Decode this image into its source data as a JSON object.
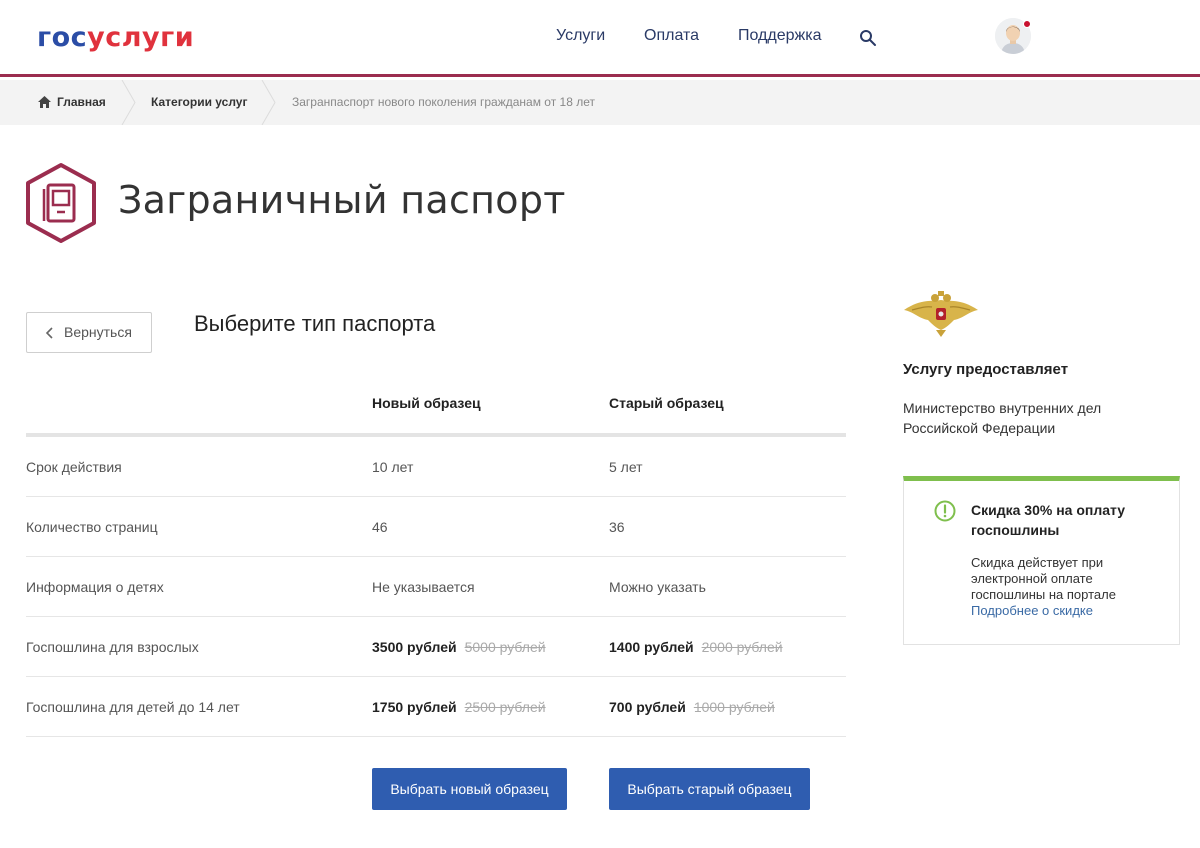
{
  "header": {
    "logo_part1": "гос",
    "logo_part2": "услуги",
    "nav": [
      "Услуги",
      "Оплата",
      "Поддержка"
    ]
  },
  "breadcrumb": {
    "home": "Главная",
    "categories": "Категории услуг",
    "current": "Загранпаспорт нового поколения гражданам от 18 лет"
  },
  "page": {
    "title": "Заграничный паспорт",
    "back_label": "Вернуться",
    "choose_title": "Выберите тип паспорта"
  },
  "table": {
    "col_new": "Новый образец",
    "col_old": "Старый образец",
    "rows": [
      {
        "label": "Срок действия",
        "new": "10 лет",
        "old": "5 лет"
      },
      {
        "label": "Количество страниц",
        "new": "46",
        "old": "36"
      },
      {
        "label": "Информация о детях",
        "new": "Не указывается",
        "old": "Можно указать"
      },
      {
        "label": "Госпошлина для взрослых",
        "new_price": "3500 рублей",
        "new_old_price": "5000 рублей",
        "old_price": "1400 рублей",
        "old_old_price": "2000 рублей"
      },
      {
        "label": "Госпошлина для детей до 14 лет",
        "new_price": "1750 рублей",
        "new_old_price": "2500 рублей",
        "old_price": "700 рублей",
        "old_old_price": "1000 рублей"
      }
    ]
  },
  "buttons": {
    "choose_new": "Выбрать новый образец",
    "choose_old": "Выбрать старый образец"
  },
  "provider": {
    "heading": "Услугу предоставляет",
    "name": "Министерство внутренних дел Российской Федерации"
  },
  "discount": {
    "title": "Скидка 30% на оплату госпошлины",
    "text": "Скидка действует при электронной оплате госпошлины на портале",
    "link": "Подробнее о скидке"
  },
  "colors": {
    "brand_blue": "#2b4da6",
    "brand_red": "#e0323d",
    "header_line": "#9b2d4f",
    "button": "#2f5db0",
    "discount_accent": "#7fbf4d"
  },
  "icons": [
    "search-icon",
    "home-icon",
    "passport-icon",
    "chevron-left-icon",
    "emblem-icon",
    "info-icon"
  ]
}
